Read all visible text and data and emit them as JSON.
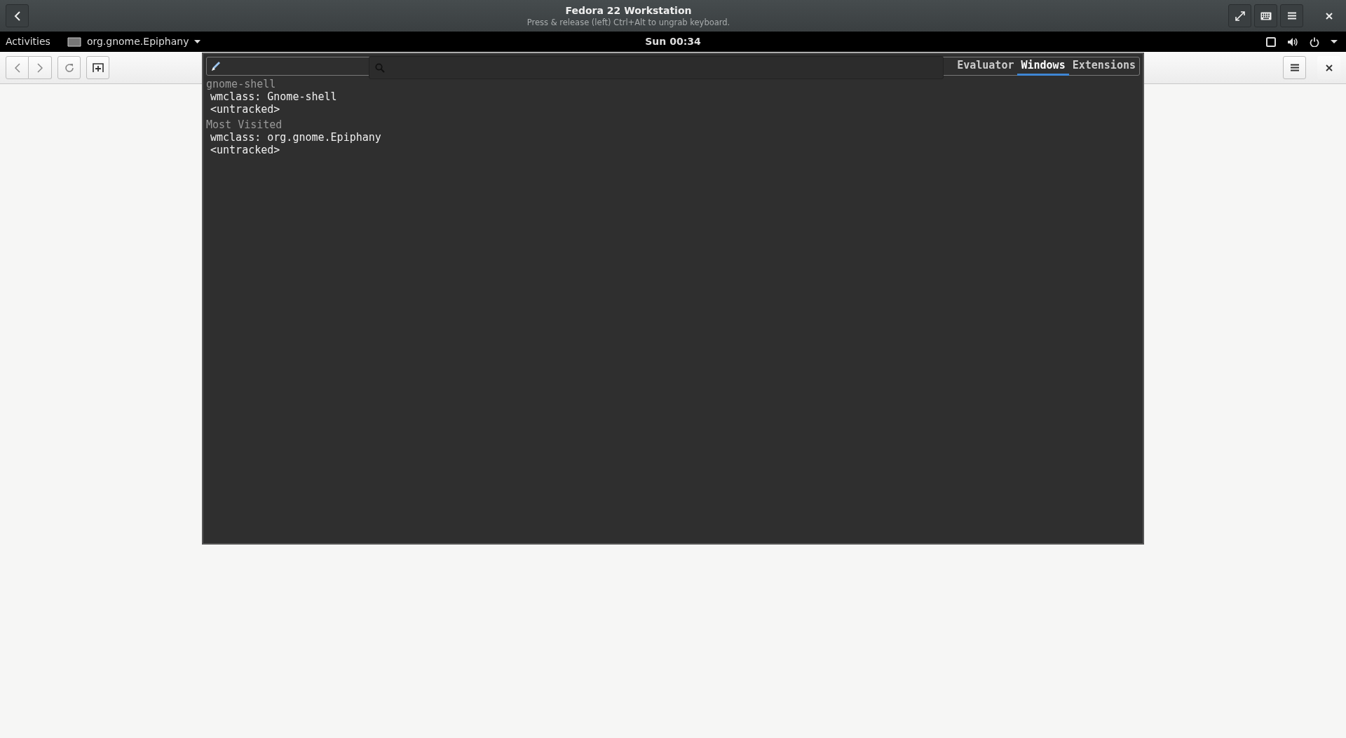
{
  "vm_header": {
    "title": "Fedora 22 Workstation",
    "subtitle": "Press & release (left) Ctrl+Alt to ungrab keyboard."
  },
  "top_bar": {
    "activities": "Activities",
    "app_menu": "org.gnome.Epiphany",
    "clock": "Sun 00:34"
  },
  "looking_glass": {
    "tabs": [
      {
        "label": "Evaluator",
        "selected": false
      },
      {
        "label": "Windows",
        "selected": true
      },
      {
        "label": "Extensions",
        "selected": false
      }
    ],
    "windows": [
      {
        "title": "gnome-shell",
        "wmclass": "wmclass: Gnome-shell",
        "app": "<untracked>"
      },
      {
        "title": "Most Visited",
        "wmclass": "wmclass: org.gnome.Epiphany",
        "app": "<untracked>"
      }
    ]
  }
}
